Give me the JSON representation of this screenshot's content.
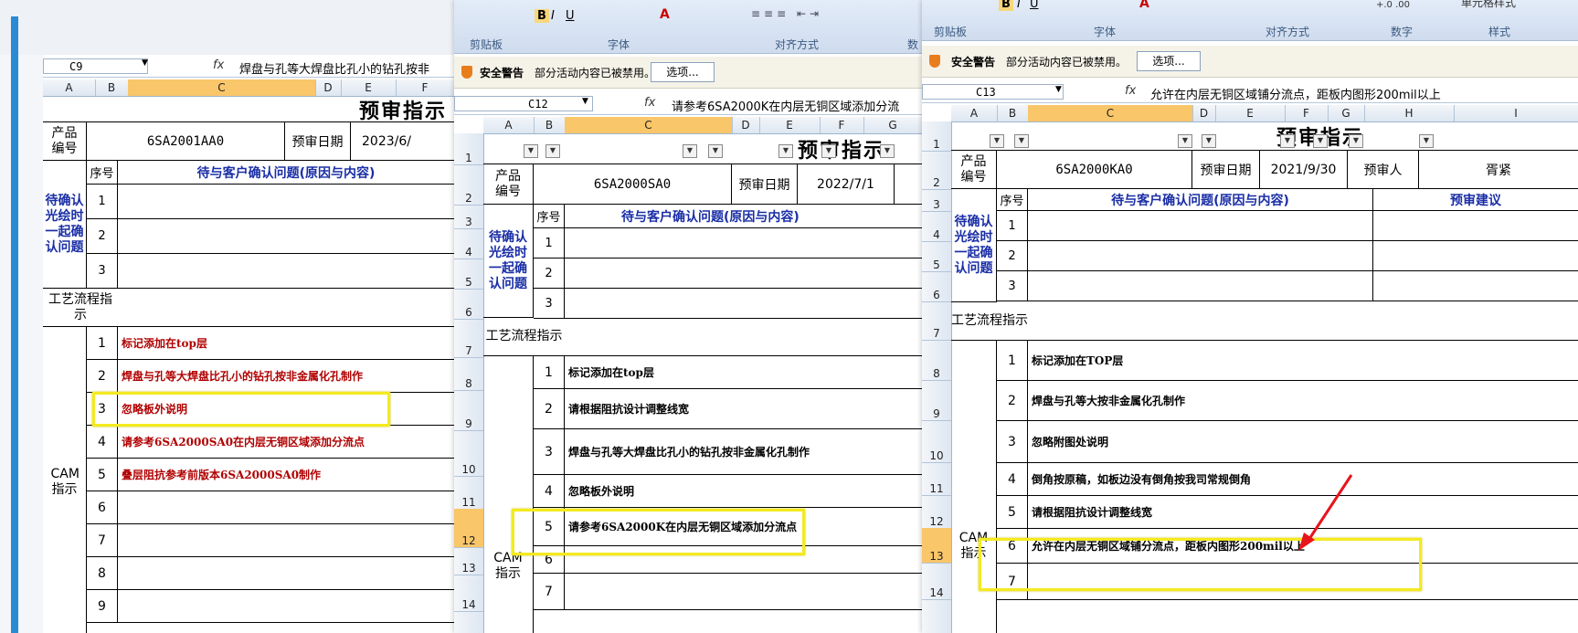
{
  "win1": {
    "cell_ref": "C9",
    "formula": "焊盘与孔等大焊盘比孔小的钻孔按非",
    "cols": [
      "A",
      "B",
      "C",
      "D",
      "E",
      "F"
    ],
    "title": "预审指示",
    "product_label": "产品编号",
    "product_code": "6SA2001AA0",
    "date_label": "预审日期",
    "date_value": "2023/6/",
    "seq_label": "序号",
    "question_header": "待与客户确认问题(原因与内容)",
    "confirm_label": "待确认光绘时一起确认问题",
    "process_label": "工艺流程指示",
    "cam_label": "CAM指示",
    "q_rows": [
      "1",
      "2",
      "3"
    ],
    "cam_rows": [
      {
        "no": "1",
        "text": "标记添加在top层"
      },
      {
        "no": "2",
        "text": "焊盘与孔等大焊盘比孔小的钻孔按非金属化孔制作"
      },
      {
        "no": "3",
        "text": "忽略板外说明"
      },
      {
        "no": "4",
        "text": "请参考6SA2000SA0在内层无铜区域添加分流点"
      },
      {
        "no": "5",
        "text": "叠层阻抗参考前版本6SA2000SA0制作"
      },
      {
        "no": "6",
        "text": ""
      },
      {
        "no": "7",
        "text": ""
      },
      {
        "no": "8",
        "text": ""
      },
      {
        "no": "9",
        "text": ""
      }
    ]
  },
  "win2": {
    "ribbon_groups": [
      "剪贴板",
      "字体",
      "对齐方式",
      "数"
    ],
    "security_title": "安全警告",
    "security_msg": "部分活动内容已被禁用。",
    "options_btn": "选项...",
    "cell_ref": "C12",
    "formula": "请参考6SA2000K在内层无铜区域添加分流",
    "cols": [
      "A",
      "B",
      "C",
      "D",
      "E",
      "F",
      "G"
    ],
    "row_nums": [
      "1",
      "2",
      "3",
      "4",
      "5",
      "6",
      "7",
      "8",
      "9",
      "10",
      "11",
      "12",
      "13",
      "14"
    ],
    "title": "预审指示",
    "product_label": "产品编号",
    "product_code": "6SA2000SA0",
    "date_label": "预审日期",
    "date_value": "2022/7/1",
    "seq_label": "序号",
    "question_header": "待与客户确认问题(原因与内容)",
    "confirm_label": "待确认光绘时一起确认问题",
    "process_label": "工艺流程指示",
    "cam_label": "CAM指示",
    "q_rows": [
      "1",
      "2",
      "3"
    ],
    "cam_rows": [
      {
        "no": "1",
        "text": "标记添加在top层"
      },
      {
        "no": "2",
        "text": "请根据阻抗设计调整线宽"
      },
      {
        "no": "3",
        "text": "焊盘与孔等大焊盘比孔小的钻孔按非金属化孔制作"
      },
      {
        "no": "4",
        "text": "忽略板外说明"
      },
      {
        "no": "5",
        "text": "请参考6SA2000K在内层无铜区域添加分流点"
      },
      {
        "no": "6",
        "text": ""
      },
      {
        "no": "7",
        "text": ""
      }
    ]
  },
  "win3": {
    "ribbon_groups": [
      "剪贴板",
      "字体",
      "对齐方式",
      "数字",
      "样式"
    ],
    "style_btn": "单元格样式",
    "security_title": "安全警告",
    "security_msg": "部分活动内容已被禁用。",
    "options_btn": "选项...",
    "cell_ref": "C13",
    "formula": "允许在内层无铜区域铺分流点，距板内图形200mil以上",
    "cols": [
      "A",
      "B",
      "C",
      "D",
      "E",
      "F",
      "G",
      "H",
      "I"
    ],
    "row_nums": [
      "1",
      "2",
      "3",
      "4",
      "5",
      "6",
      "7",
      "8",
      "9",
      "10",
      "11",
      "12",
      "13",
      "14"
    ],
    "title": "预审指示",
    "product_label": "产品编号",
    "product_code": "6SA2000KA0",
    "date_label": "预审日期",
    "date_value": "2021/9/30",
    "reviewer_label": "预审人",
    "reviewer_value": "胥紧",
    "seq_label": "序号",
    "question_header": "待与客户确认问题(原因与内容)",
    "suggestion_header": "预审建议",
    "confirm_label": "待确认光绘时一起确认问题",
    "process_label": "工艺流程指示",
    "cam_label": "CAM指示",
    "q_rows": [
      "1",
      "2",
      "3"
    ],
    "cam_rows": [
      {
        "no": "1",
        "text": "标记添加在TOP层"
      },
      {
        "no": "2",
        "text": "焊盘与孔等大按非金属化孔制作"
      },
      {
        "no": "3",
        "text": "忽略附图处说明"
      },
      {
        "no": "4",
        "text": "倒角按原稿，如板边没有倒角按我司常规倒角"
      },
      {
        "no": "5",
        "text": "请根据阻抗设计调整线宽"
      },
      {
        "no": "6",
        "text": "允许在内层无铜区域铺分流点，距板内图形200mil以上"
      },
      {
        "no": "7",
        "text": ""
      }
    ]
  },
  "colors": {
    "highlight": "#f4ea20",
    "arrow": "#e8141c",
    "blue_text": "#1a2ea6",
    "red_text": "#b00000"
  }
}
